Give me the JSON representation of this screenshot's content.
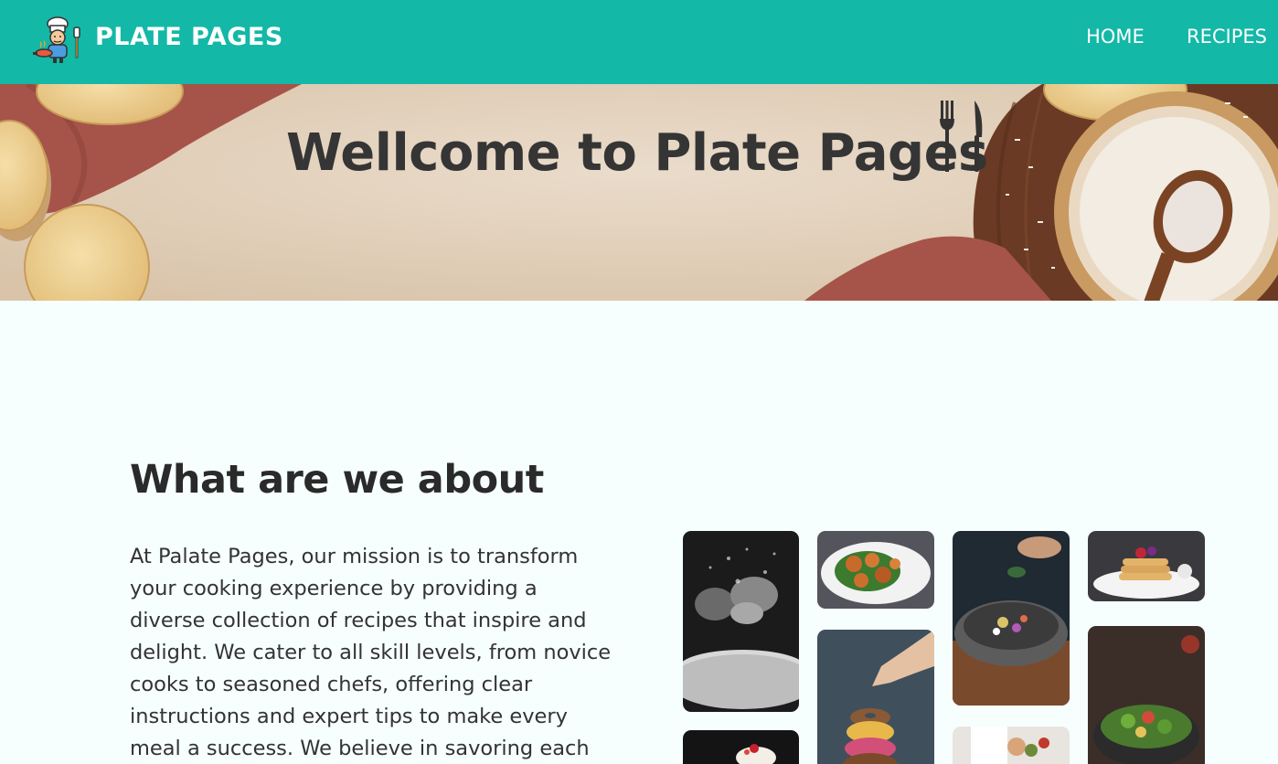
{
  "header": {
    "brand": "PLATE PAGES",
    "logo_icon": "chef-cooking-icon",
    "nav": [
      {
        "label": "HOME"
      },
      {
        "label": "RECIPES"
      }
    ]
  },
  "hero": {
    "title": "Wellcome to Plate Pages",
    "icon": "fork-knife-icon"
  },
  "about": {
    "heading": "What are we about",
    "text": "At Palate Pages, our mission is to transform your cooking experience by providing a diverse collection of recipes that inspire and delight. We cater to all skill levels, from novice cooks to seasoned chefs, offering clear instructions and expert tips to make every meal a success. We believe in savoring each"
  },
  "gallery": {
    "photos": [
      {
        "name": "flour-hands-photo"
      },
      {
        "name": "chicken-salad-photo"
      },
      {
        "name": "seasoning-bowl-photo"
      },
      {
        "name": "pancakes-photo"
      },
      {
        "name": "donut-stack-photo"
      },
      {
        "name": "buddha-bowl-photo"
      },
      {
        "name": "dessert-cup-photo"
      },
      {
        "name": "chef-plating-photo"
      }
    ]
  },
  "colors": {
    "navbar": "#13b8a7",
    "page_background": "#f6fffe",
    "text": "#2f2f2f"
  }
}
